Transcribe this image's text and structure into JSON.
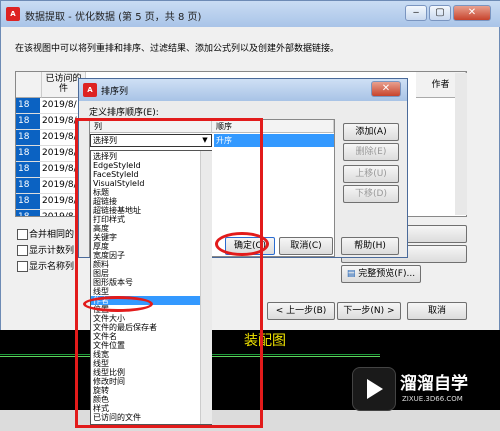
{
  "window": {
    "title": "数据提取 - 优化数据 (第 5 页，共 8 页)",
    "description": "在该视图中可以将列重排和排序、过滤结果、添加公式列以及创建外部数据链接。"
  },
  "bg_table": {
    "headers": [
      "",
      "已访问的\n件",
      "作者"
    ],
    "rows": [
      {
        "num": "18",
        "date": "2019/8/"
      },
      {
        "num": "18",
        "date": "2019/8/"
      },
      {
        "num": "18",
        "date": "2019/8/"
      },
      {
        "num": "18",
        "date": "2019/8/"
      },
      {
        "num": "18",
        "date": "2019/8/"
      },
      {
        "num": "18",
        "date": "2019/8/"
      },
      {
        "num": "18",
        "date": "2019/8/"
      },
      {
        "num": "18",
        "date": "2019/8/"
      }
    ]
  },
  "options": {
    "merge": "合并相同的",
    "show_count": "显示计数列",
    "show_name": "显示名称列"
  },
  "buttons": {
    "full_preview": "完整预览(F)...",
    "back": "< 上一步(B)",
    "next": "下一步(N) >",
    "cancel_bottom": "取消"
  },
  "sort_dialog": {
    "title": "排序列",
    "define_label": "定义排序顺序(E):",
    "col_header": "列",
    "order_header": "顺序",
    "combo_value": "选择列",
    "order_value": "升序",
    "add": "添加(A)",
    "delete": "删除(E)",
    "up": "上移(U)",
    "down": "下移(D)",
    "ok": "确定(O)",
    "cancel": "取消(C)",
    "help": "帮助(H)"
  },
  "dropdown_items": [
    "选择列",
    "EdgeStyleId",
    "FaceStyleId",
    "VisualStyleId",
    "标题",
    "超链接",
    "超链接基地址",
    "打印样式",
    "高度",
    "关键字",
    "厚度",
    "宽度因子",
    "颜料",
    "图层",
    "图形版本号",
    "线型",
    "作者",
    "位置",
    "文件大小",
    "文件的最后保存者",
    "文件名",
    "文件位置",
    "线宽",
    "线型",
    "线型比例",
    "修改时间",
    "旋转",
    "颜色",
    "样式",
    "已访问的文件"
  ],
  "selected_index": 16,
  "cad_text": "装配图",
  "watermark": {
    "name": "溜溜自学",
    "url": "ZIXUE.3D66.COM"
  },
  "colors": {
    "highlight": "#3399ff",
    "annotation": "#e21b1b",
    "row_num": "#0b62c2"
  }
}
